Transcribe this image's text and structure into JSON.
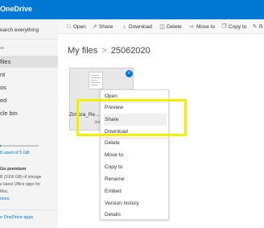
{
  "header": {
    "app_title": "OneDrive"
  },
  "sidebar": {
    "search_placeholder": "earch everything",
    "section_label": "ve",
    "items": [
      {
        "label": "files",
        "active": true
      },
      {
        "label": "nt",
        "active": false
      },
      {
        "label": "os",
        "active": false
      },
      {
        "label": "ed",
        "active": false
      },
      {
        "label": "cle bin",
        "active": false
      }
    ],
    "storage_text": "8 used of 5 GB",
    "storage_fraction": 0.02,
    "premium": {
      "title": "Go premium",
      "lines": [
        "B (1000 GB) of storage",
        "e latest Office apps for",
        "Mac."
      ],
      "learn_more": "more."
    },
    "get_apps": "e OneDrive apps"
  },
  "toolbar": {
    "commands": [
      {
        "label": "Open",
        "icon": "open-icon"
      },
      {
        "label": "Share",
        "icon": "share-icon"
      },
      {
        "label": "Download",
        "icon": "download-icon"
      },
      {
        "label": "Delete",
        "icon": "delete-icon"
      },
      {
        "label": "Move to",
        "icon": "move-icon"
      },
      {
        "label": "Copy to",
        "icon": "copy-icon"
      },
      {
        "label": "R",
        "icon": "rename-icon"
      }
    ]
  },
  "breadcrumb": {
    "root": "My files",
    "separator": ">",
    "current": "25062020"
  },
  "file": {
    "name": "Zimbra_Re...",
    "date": "Jun"
  },
  "context_menu": {
    "items": [
      "Open",
      "Preview",
      "Share",
      "Download",
      "Delete",
      "Move to",
      "Copy to",
      "Rename",
      "Embed",
      "Version history",
      "Details"
    ],
    "hovered": "Share"
  },
  "colors": {
    "brand": "#0078d4",
    "highlight": "#f2f000"
  }
}
